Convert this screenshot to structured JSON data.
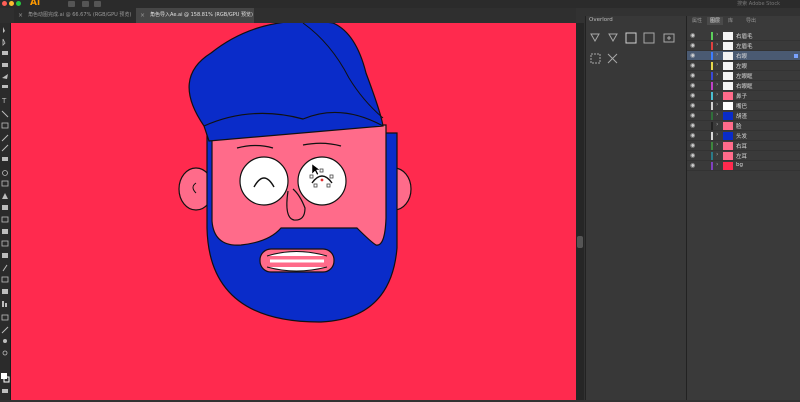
{
  "app": {
    "logo": "Ai",
    "top_right_hint": "搜索 Adobe Stock"
  },
  "tabs": [
    {
      "label": "角色动图完成.ai @ 66.67% (RGB/GPU 预览)",
      "close": "×"
    },
    {
      "label": "角色导入Ae.ai @ 158.81% (RGB/GPU 预览)",
      "close": "×"
    }
  ],
  "overlord": {
    "title": "Overlord"
  },
  "panel_tabs": [
    "属性",
    "图层",
    "库",
    "导出"
  ],
  "layers": [
    {
      "name": "右眉毛",
      "color": "#5bd05b",
      "selected": false,
      "thumb": "#f4f4f4"
    },
    {
      "name": "左眉毛",
      "color": "#e04040",
      "selected": false,
      "thumb": "#f4f4f4"
    },
    {
      "name": "右眼",
      "color": "#3d7cff",
      "selected": true,
      "thumb": "#f4f4f4"
    },
    {
      "name": "左眼",
      "color": "#e6d84a",
      "selected": false,
      "thumb": "#f4f4f4"
    },
    {
      "name": "左眼眶",
      "color": "#3a49d8",
      "selected": false,
      "thumb": "#f4f4f4"
    },
    {
      "name": "右眼眶",
      "color": "#c040c8",
      "selected": false,
      "thumb": "#f4f4f4"
    },
    {
      "name": "鼻子",
      "color": "#4ac0d0",
      "selected": false,
      "thumb": "#ff6b8a"
    },
    {
      "name": "嘴巴",
      "color": "#d0d0d0",
      "selected": false,
      "thumb": "#ffffff"
    },
    {
      "name": "胡渣",
      "color": "#2f6f3a",
      "selected": false,
      "thumb": "#0a2cc9"
    },
    {
      "name": "脸",
      "color": "#222222",
      "selected": false,
      "thumb": "#ff6b8a"
    },
    {
      "name": "头发",
      "color": "#d8d8d8",
      "selected": false,
      "thumb": "#0a2cc9"
    },
    {
      "name": "右耳",
      "color": "#3c8a3c",
      "selected": false,
      "thumb": "#ff6b8a"
    },
    {
      "name": "左耳",
      "color": "#2a7a88",
      "selected": false,
      "thumb": "#ff6b8a"
    },
    {
      "name": "bg",
      "color": "#8040c0",
      "selected": false,
      "thumb": "#ff2a4e"
    }
  ],
  "colors": {
    "canvas_bg": "#ff2a4e",
    "skin": "#ff6b8a",
    "hair": "#0a2cc9"
  }
}
